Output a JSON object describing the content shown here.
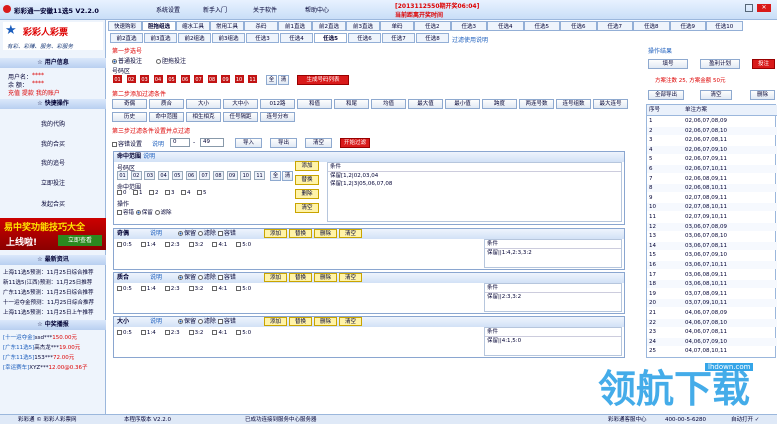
{
  "app": {
    "title": "彩彩通一安徽11选5  V2.2.0",
    "menu": [
      "系统设置",
      "新手入门",
      "关于软件",
      "帮助中心"
    ],
    "notice": "[2013112550期开奖06:04]",
    "notice2": "当前距离开奖时间"
  },
  "brand": {
    "logo_text": "彩彩人彩票",
    "slogan": "有彩、彩赚、服务、彩服务"
  },
  "top_tabs": [
    "快速购彩",
    "胆拖组选",
    "缩水工具",
    "常用工具",
    "杀码",
    "前1直选",
    "前2直选",
    "前3直选",
    "单码",
    "任选2",
    "任选3",
    "任选4",
    "任选5",
    "任选6",
    "任选7",
    "任选8",
    "任选9",
    "任选10"
  ],
  "sub_tabs": [
    "前2直选",
    "前3直选",
    "前2组选",
    "前3组选",
    "任选3",
    "任选4",
    "任选5",
    "任选6",
    "任选7",
    "任选8"
  ],
  "sub_tab_hint": "过滤使用说明",
  "user": {
    "header": "用户信息",
    "name_label": "用户名：",
    "name_val": "****",
    "balance_label": "余  额：",
    "balance_val": "****",
    "links": "充值 提款 我的账户"
  },
  "quick": {
    "header": "快捷操作",
    "items": [
      "我的代购",
      "我的合买",
      "我的追号",
      "立即投注",
      "发起合买"
    ]
  },
  "promo": {
    "line1": "易中奖功能技巧大全",
    "line2": "上线啦!",
    "btn": "立即查看"
  },
  "news": {
    "header": "最新资讯",
    "items": [
      "上海11选5预测：11月25日综合推荐",
      "新11选5(江西)预测：11月25日推荐",
      "广东11选5预测：11月25日综合推荐",
      "十一运夺金预测：11月25日综合推荐",
      "上海11选5预测：11月25日上午推荐"
    ]
  },
  "winners": {
    "header": "中奖播报",
    "items": [
      [
        "[十一运夺金]",
        "ssd***",
        "150.00元"
      ],
      [
        "[广东11选5]",
        "高杰龙***",
        "19.00元"
      ],
      [
        "[广东11选5]",
        "153***",
        "72.00元"
      ],
      [
        "[幸运赛车]",
        "XYZ***",
        "12.00@0.36子"
      ]
    ]
  },
  "step1": {
    "title": "第一步选号",
    "opt1": "普通投注",
    "opt2": "胆拖投注",
    "zone": "号码区",
    "balls": [
      "01",
      "02",
      "03",
      "04",
      "05",
      "06",
      "07",
      "08",
      "09",
      "10",
      "11"
    ],
    "btn_all": "全",
    "btn_clear": "清",
    "btn_gen": "生成号码列表"
  },
  "step2": {
    "title": "第二步添加过滤条件",
    "row1": [
      "奇偶",
      "质合",
      "大小",
      "大中小",
      "012路",
      "和值",
      "和尾",
      "均值",
      "最大值",
      "最小值",
      "跨度",
      "两连号数",
      "连号组数",
      "最大连号"
    ],
    "row2": [
      "历史",
      "命中范围",
      "相生相克",
      "任号隔距",
      "连号分布"
    ]
  },
  "step3": {
    "title": "第三步过滤条件设置并点过滤",
    "chk": "容错设置",
    "hint": "说明",
    "from": "0",
    "to": "49",
    "import": "导入",
    "export": "导出",
    "clear": "清空",
    "run": "开始过滤"
  },
  "hit_panel": {
    "title": "命中范围",
    "hint": "说明",
    "zone": "号码区",
    "balls": [
      "01",
      "02",
      "03",
      "04",
      "05",
      "06",
      "07",
      "08",
      "09",
      "10",
      "11"
    ],
    "all": "全",
    "clr": "清",
    "range_label": "命中范围",
    "range_items": [
      "0",
      "1",
      "2",
      "3",
      "4",
      "5"
    ],
    "op_label": "操作",
    "op_err": "容错",
    "op_keep": "保留",
    "op_filter": "滤除",
    "btns": [
      "添加",
      "替换",
      "删除",
      "清空"
    ],
    "cond_title": "条件",
    "cond_lines": [
      "保留[1,2|02,03,04",
      "保留[1,2|3|05,06,07,08"
    ]
  },
  "oe_panel": {
    "title": "奇偶",
    "hint": "说明",
    "keep": "保留",
    "filter": "滤除",
    "err": "容错",
    "btns": [
      "添加",
      "替换",
      "删除",
      "清空"
    ],
    "ratios": [
      "0:5",
      "1:4",
      "2:3",
      "3:2",
      "4:1",
      "5:0"
    ],
    "cond_title": "条件",
    "cond_line": "保留||1:4,2:3,3:2"
  },
  "pc_panel": {
    "title": "质合",
    "hint": "说明",
    "keep": "保留",
    "filter": "滤除",
    "err": "容错",
    "btns": [
      "添加",
      "替换",
      "删除",
      "清空"
    ],
    "ratios": [
      "0:5",
      "1:4",
      "2:3",
      "3:2",
      "4:1",
      "5:0"
    ],
    "cond_title": "条件",
    "cond_line": "保留||2:3,3:2"
  },
  "bs_panel": {
    "title": "大小",
    "hint": "说明",
    "keep": "保留",
    "filter": "滤除",
    "err": "容错",
    "btns": [
      "添加",
      "替换",
      "删除",
      "清空"
    ],
    "ratios": [
      "0:5",
      "1:4",
      "2:3",
      "3:2",
      "4:1",
      "5:0"
    ],
    "cond_title": "条件",
    "cond_line": "保留||4:1,5:0"
  },
  "result": {
    "title": "操作结果",
    "btn_fill": "填号",
    "btn_profit": "盈利计划",
    "btn_buy": "投注",
    "summary": "方案注数 25, 方案金额 50元",
    "export": "全部导出",
    "clear": "清空",
    "delete": "删除",
    "col1": "序号",
    "col2": "单注方案",
    "rows": [
      [
        "1",
        "02,06,07,08,09"
      ],
      [
        "2",
        "02,06,07,08,10"
      ],
      [
        "3",
        "02,06,07,08,11"
      ],
      [
        "4",
        "02,06,07,09,10"
      ],
      [
        "5",
        "02,06,07,09,11"
      ],
      [
        "6",
        "02,06,07,10,11"
      ],
      [
        "7",
        "02,06,08,09,11"
      ],
      [
        "8",
        "02,06,08,10,11"
      ],
      [
        "9",
        "02,07,08,09,11"
      ],
      [
        "10",
        "02,07,08,10,11"
      ],
      [
        "11",
        "02,07,09,10,11"
      ],
      [
        "12",
        "03,06,07,08,09"
      ],
      [
        "13",
        "03,06,07,08,10"
      ],
      [
        "14",
        "03,06,07,08,11"
      ],
      [
        "15",
        "03,06,07,09,10"
      ],
      [
        "16",
        "03,06,07,10,11"
      ],
      [
        "17",
        "03,06,08,09,11"
      ],
      [
        "18",
        "03,06,08,10,11"
      ],
      [
        "19",
        "03,07,08,09,11"
      ],
      [
        "20",
        "03,07,09,10,11"
      ],
      [
        "21",
        "04,06,07,08,09"
      ],
      [
        "22",
        "04,06,07,08,10"
      ],
      [
        "23",
        "04,06,07,08,11"
      ],
      [
        "24",
        "04,06,07,09,10"
      ],
      [
        "25",
        "04,07,08,10,11"
      ]
    ]
  },
  "status": {
    "s1": "彩彩通 © 彩彩人彩票网",
    "s2": "本程序版本 V2.2.0",
    "s3": "已成功连接到服务中心服务器",
    "s4": "彩彩通客服中心",
    "s5": "400-00-5-6280",
    "s6": "自动打开 ✓"
  },
  "watermark": "领航下载",
  "watermark_url": "lhdown.com",
  "colors": {
    "accent": "#1c5ebd",
    "red": "#d91a1a"
  }
}
